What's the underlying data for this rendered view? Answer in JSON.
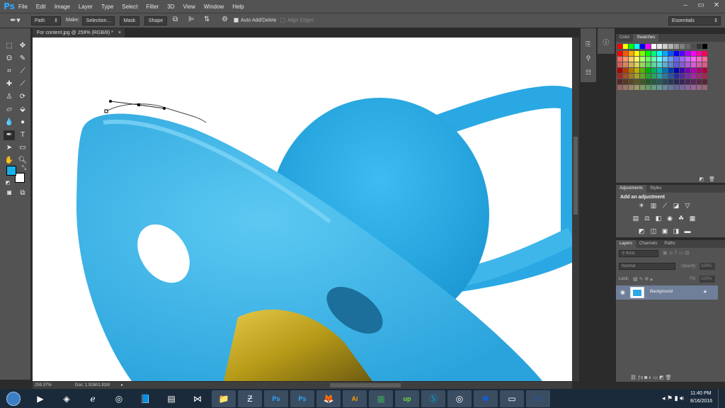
{
  "app": {
    "logo": "Ps"
  },
  "menu": [
    "File",
    "Edit",
    "Image",
    "Layer",
    "Type",
    "Select",
    "Filter",
    "3D",
    "View",
    "Window",
    "Help"
  ],
  "window_controls": [
    "–",
    "▭",
    "✕"
  ],
  "options": {
    "tool_mode": "Path",
    "make_label": "Make:",
    "selection_btn": "Selection...",
    "mask_btn": "Mask",
    "shape_btn": "Shape",
    "auto_add_delete": "Auto Add/Delete",
    "align_edges": "Align Edges",
    "workspace": "Essentials"
  },
  "document": {
    "tab_title": "For content.jpg @ 259% (RGB/8) *",
    "zoom": "259.37%",
    "doc_info": "Doc: 1.91M/1.91M"
  },
  "swatches_panel": {
    "tabs": [
      "Color",
      "Swatches"
    ],
    "active": "Swatches"
  },
  "adjustments_panel": {
    "tabs": [
      "Adjustments",
      "Styles"
    ],
    "heading": "Add an adjustment"
  },
  "layers_panel": {
    "tabs": [
      "Layers",
      "Channels",
      "Paths"
    ],
    "filter_kind": "Kind",
    "blend_mode": "Normal",
    "opacity_label": "Opacity:",
    "opacity_value": "100%",
    "lock_label": "Lock:",
    "fill_label": "Fill:",
    "fill_value": "100%",
    "layers": [
      {
        "name": "Background"
      }
    ]
  },
  "colors": {
    "foreground": "#17b2ea",
    "background": "#ffffff",
    "accent": "#31a8ff"
  },
  "taskbar": {
    "apps": [
      "media-player",
      "winamp",
      "internet-explorer",
      "chrome",
      "book",
      "windows-explorer",
      "visual-studio",
      "folder",
      "filezilla",
      "photoshop",
      "photoshop",
      "firefox",
      "illustrator",
      "excel",
      "upwork",
      "skype",
      "chrome",
      "dropbox",
      "remote-desktop",
      "word"
    ],
    "clock_time": "11:40 PM",
    "clock_date": "8/16/2016"
  }
}
